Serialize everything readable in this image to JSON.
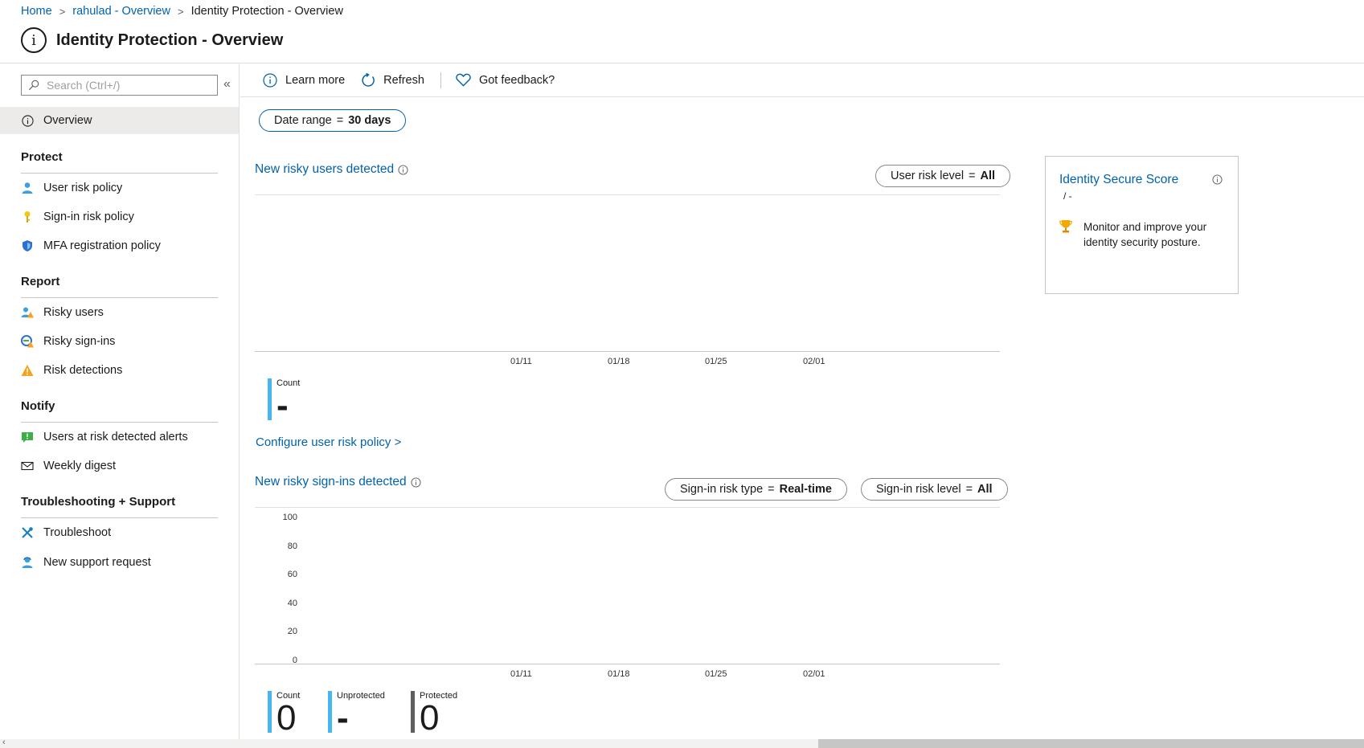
{
  "breadcrumb": {
    "items": [
      "Home",
      "rahulad - Overview",
      "Identity Protection - Overview"
    ],
    "separator": ">"
  },
  "page": {
    "title": "Identity Protection - Overview",
    "title_icon": "info-icon"
  },
  "sidebar": {
    "search_placeholder": "Search (Ctrl+/)",
    "collapse_label": "«",
    "overview_label": "Overview",
    "sections": {
      "protect": "Protect",
      "report": "Report",
      "notify": "Notify",
      "troubleshooting": "Troubleshooting + Support"
    },
    "items": {
      "user_risk_policy": "User risk policy",
      "signin_risk_policy": "Sign-in risk policy",
      "mfa_registration_policy": "MFA registration policy",
      "risky_users": "Risky users",
      "risky_signins": "Risky sign-ins",
      "risk_detections": "Risk detections",
      "users_at_risk_alerts": "Users at risk detected alerts",
      "weekly_digest": "Weekly digest",
      "troubleshoot": "Troubleshoot",
      "new_support_request": "New support request"
    }
  },
  "toolbar": {
    "learn_more": "Learn more",
    "refresh": "Refresh",
    "feedback": "Got feedback?"
  },
  "filters": {
    "date_range_label": "Date range",
    "date_range_value": "30 days",
    "user_risk_level_label": "User risk level",
    "user_risk_level_value": "All",
    "signin_risk_type_label": "Sign-in risk type",
    "signin_risk_type_value": "Real-time",
    "signin_risk_level_label": "Sign-in risk level",
    "signin_risk_level_value": "All",
    "equals": "="
  },
  "risky_users_panel": {
    "title": "New risky users detected",
    "configure_link": "Configure user risk policy >",
    "metrics": [
      {
        "label": "Count",
        "value": "-",
        "color": "#47b6f0"
      }
    ]
  },
  "risky_signins_panel": {
    "title": "New risky sign-ins detected",
    "metrics": [
      {
        "label": "Count",
        "value": "0",
        "color": "#47b6f0"
      },
      {
        "label": "Unprotected",
        "value": "-",
        "color": "#47b6f0"
      },
      {
        "label": "Protected",
        "value": "0",
        "color": "#605e5c"
      }
    ]
  },
  "chart_data": [
    {
      "type": "line",
      "title": "New risky users detected",
      "x": [
        "01/11",
        "01/18",
        "01/25",
        "02/01"
      ],
      "series": []
    },
    {
      "type": "line",
      "title": "New risky sign-ins detected",
      "x": [
        "01/11",
        "01/18",
        "01/25",
        "02/01"
      ],
      "y_ticks": [
        "100",
        "80",
        "60",
        "40",
        "20",
        "0"
      ],
      "ylim": [
        0,
        100
      ],
      "series": []
    }
  ],
  "score_card": {
    "title": "Identity Secure Score",
    "value": "/ -",
    "description": "Monitor and improve your identity security posture."
  },
  "colors": {
    "accent": "#0062ad",
    "metric_blue": "#47b6f0",
    "metric_gray": "#605e5c"
  }
}
